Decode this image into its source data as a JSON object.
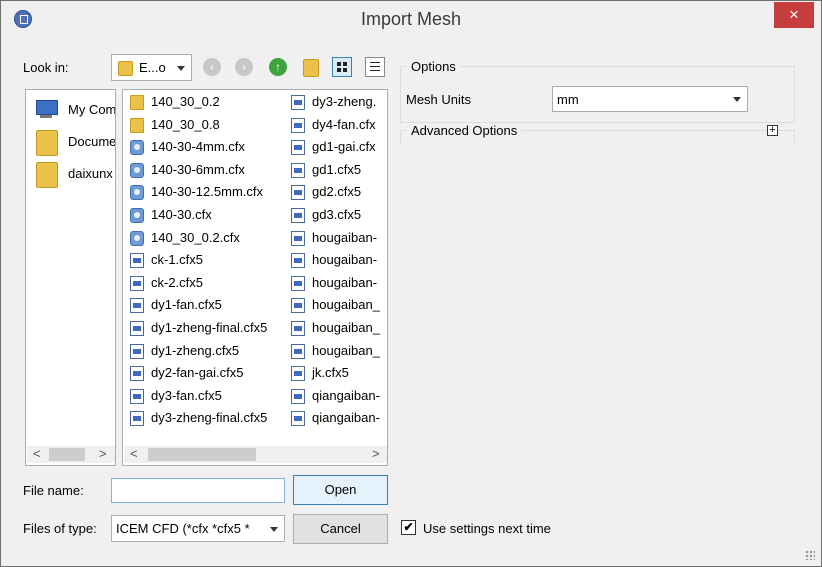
{
  "window": {
    "title": "Import Mesh",
    "close_label": "×"
  },
  "look_in": {
    "label": "Look in:",
    "value": "E...o"
  },
  "places": [
    {
      "label": "My Com",
      "icon": "computer-icon"
    },
    {
      "label": "Docume",
      "icon": "folder-icon"
    },
    {
      "label": "daixunx",
      "icon": "folder-icon"
    }
  ],
  "files_col1": [
    {
      "name": "140_30_0.2",
      "type": "folder"
    },
    {
      "name": "140_30_0.8",
      "type": "folder"
    },
    {
      "name": "140-30-4mm.cfx",
      "type": "cfx"
    },
    {
      "name": "140-30-6mm.cfx",
      "type": "cfx"
    },
    {
      "name": "140-30-12.5mm.cfx",
      "type": "cfx"
    },
    {
      "name": "140-30.cfx",
      "type": "cfx"
    },
    {
      "name": "140_30_0.2.cfx",
      "type": "cfx"
    },
    {
      "name": "ck-1.cfx5",
      "type": "cfx5"
    },
    {
      "name": "ck-2.cfx5",
      "type": "cfx5"
    },
    {
      "name": "dy1-fan.cfx5",
      "type": "cfx5"
    },
    {
      "name": "dy1-zheng-final.cfx5",
      "type": "cfx5"
    },
    {
      "name": "dy1-zheng.cfx5",
      "type": "cfx5"
    },
    {
      "name": "dy2-fan-gai.cfx5",
      "type": "cfx5"
    },
    {
      "name": "dy3-fan.cfx5",
      "type": "cfx5"
    },
    {
      "name": "dy3-zheng-final.cfx5",
      "type": "cfx5"
    }
  ],
  "files_col2": [
    {
      "name": "dy3-zheng.",
      "type": "cfx5"
    },
    {
      "name": "dy4-fan.cfx",
      "type": "cfx5"
    },
    {
      "name": "gd1-gai.cfx",
      "type": "cfx5"
    },
    {
      "name": "gd1.cfx5",
      "type": "cfx5"
    },
    {
      "name": "gd2.cfx5",
      "type": "cfx5"
    },
    {
      "name": "gd3.cfx5",
      "type": "cfx5"
    },
    {
      "name": "hougaiban-",
      "type": "cfx5"
    },
    {
      "name": "hougaiban-",
      "type": "cfx5"
    },
    {
      "name": "hougaiban-",
      "type": "cfx5"
    },
    {
      "name": "hougaiban_",
      "type": "cfx5"
    },
    {
      "name": "hougaiban_",
      "type": "cfx5"
    },
    {
      "name": "hougaiban_",
      "type": "cfx5"
    },
    {
      "name": "jk.cfx5",
      "type": "cfx5"
    },
    {
      "name": "qiangaiban-",
      "type": "cfx5"
    },
    {
      "name": "qiangaiban-",
      "type": "cfx5"
    }
  ],
  "file_name": {
    "label": "File name:",
    "value": ""
  },
  "files_of_type": {
    "label": "Files of type:",
    "value": "ICEM CFD (*cfx *cfx5 *"
  },
  "buttons": {
    "open": "Open",
    "cancel": "Cancel"
  },
  "options": {
    "group_title": "Options",
    "mesh_units_label": "Mesh Units",
    "mesh_units_value": "mm",
    "advanced_label": "Advanced Options",
    "expand_label": "+"
  },
  "use_settings": {
    "label": "Use settings next time",
    "checked": true,
    "mark": "✔"
  },
  "scroll": {
    "left": "<",
    "right": ">"
  }
}
